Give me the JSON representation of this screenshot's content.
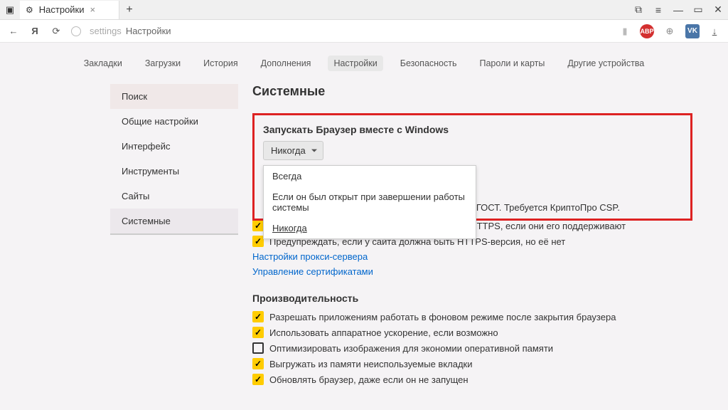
{
  "titlebar": {
    "tab_title": "Настройки"
  },
  "address": {
    "prefix": "settings",
    "page": "Настройки"
  },
  "topnav": {
    "items": [
      "Закладки",
      "Загрузки",
      "История",
      "Дополнения",
      "Настройки",
      "Безопасность",
      "Пароли и карты",
      "Другие устройства"
    ],
    "active": 4
  },
  "sidebar": {
    "items": [
      "Поиск",
      "Общие настройки",
      "Интерфейс",
      "Инструменты",
      "Сайты",
      "Системные"
    ],
    "search": 0,
    "selected": 5
  },
  "page": {
    "title": "Системные",
    "startup": {
      "heading": "Запускать Браузер вместе с Windows",
      "selected": "Никогда",
      "options": [
        "Всегда",
        "Если он был открыт при завершении работы системы",
        "Никогда"
      ]
    },
    "net_trail": "о ГОСТ. Требуется КриптоПро CSP.",
    "checks": [
      {
        "checked": true,
        "label": "Автоматически открывать сайты по протоколу HTTPS, если они его поддерживают"
      },
      {
        "checked": true,
        "label": "Предупреждать, если у сайта должна быть HTTPS-версия, но её нет"
      }
    ],
    "links": [
      "Настройки прокси-сервера",
      "Управление сертификатами"
    ],
    "perf": {
      "heading": "Производительность",
      "items": [
        {
          "checked": true,
          "label": "Разрешать приложениям работать в фоновом режиме после закрытия браузера"
        },
        {
          "checked": true,
          "label": "Использовать аппаратное ускорение, если возможно"
        },
        {
          "checked": false,
          "label": "Оптимизировать изображения для экономии оперативной памяти"
        },
        {
          "checked": true,
          "label": "Выгружать из памяти неиспользуемые вкладки"
        },
        {
          "checked": true,
          "label": "Обновлять браузер, даже если он не запущен"
        }
      ]
    }
  }
}
